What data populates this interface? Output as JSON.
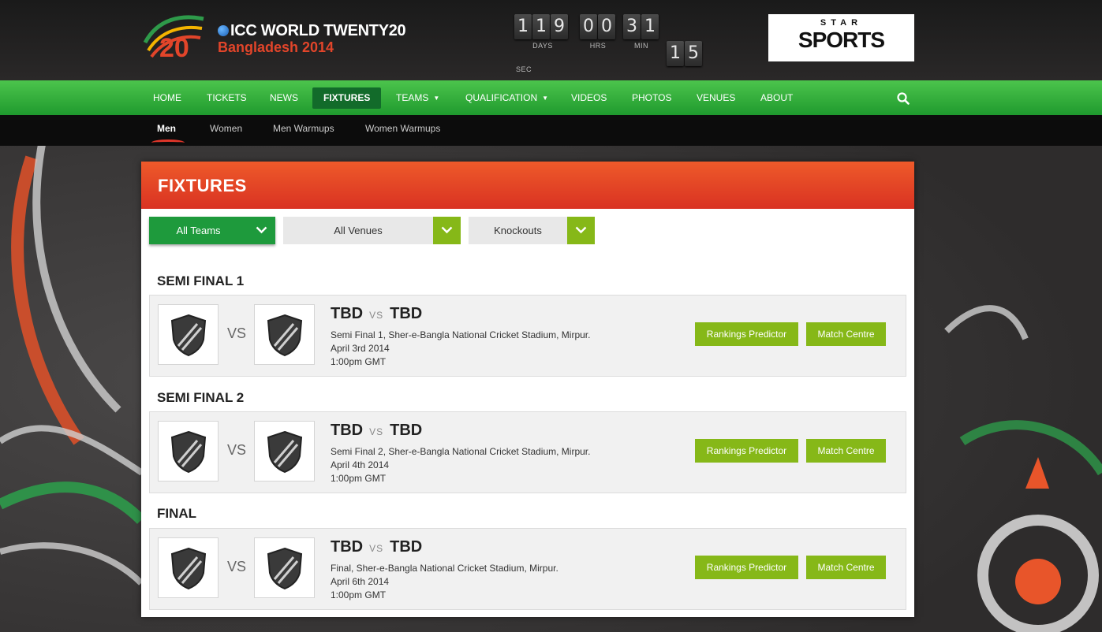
{
  "header": {
    "logo_number": "20",
    "title": "ICC WORLD TWENTY20",
    "subtitle": "Bangladesh 2014",
    "countdown": {
      "days": [
        "1",
        "1",
        "9"
      ],
      "hours": [
        "0",
        "0"
      ],
      "minutes": [
        "3",
        "1"
      ],
      "seconds": [
        "1",
        "5"
      ],
      "labels": {
        "days": "DAYS",
        "hours": "HRS",
        "minutes": "MIN",
        "seconds": "SEC"
      }
    },
    "sponsor": {
      "top": "STAR",
      "main": "SPORTS"
    }
  },
  "nav": {
    "items": [
      {
        "label": "HOME"
      },
      {
        "label": "TICKETS"
      },
      {
        "label": "NEWS"
      },
      {
        "label": "FIXTURES",
        "active": true
      },
      {
        "label": "TEAMS",
        "dropdown": true
      },
      {
        "label": "QUALIFICATION",
        "dropdown": true
      },
      {
        "label": "VIDEOS"
      },
      {
        "label": "PHOTOS"
      },
      {
        "label": "VENUES"
      },
      {
        "label": "ABOUT"
      }
    ],
    "search_icon": "search-icon"
  },
  "subnav": {
    "items": [
      {
        "label": "Men",
        "active": true
      },
      {
        "label": "Women"
      },
      {
        "label": "Men Warmups"
      },
      {
        "label": "Women Warmups"
      }
    ]
  },
  "panel": {
    "title": "FIXTURES",
    "filters": {
      "teams": "All Teams",
      "venues": "All Venues",
      "stage": "Knockouts"
    },
    "sections": [
      {
        "title": "SEMI FINAL 1",
        "match": {
          "team1": "TBD",
          "vs_small": "VS",
          "team2": "TBD",
          "vs_big": "VS",
          "venue": "Semi Final 1, Sher-e-Bangla National Cricket Stadium, Mirpur.",
          "date": "April 3rd 2014",
          "time": "1:00pm GMT",
          "predictor_label": "Rankings Predictor",
          "centre_label": "Match Centre"
        }
      },
      {
        "title": "SEMI FINAL 2",
        "match": {
          "team1": "TBD",
          "vs_small": "VS",
          "team2": "TBD",
          "vs_big": "VS",
          "venue": "Semi Final 2, Sher-e-Bangla National Cricket Stadium, Mirpur.",
          "date": "April 4th 2014",
          "time": "1:00pm GMT",
          "predictor_label": "Rankings Predictor",
          "centre_label": "Match Centre"
        }
      },
      {
        "title": "FINAL",
        "match": {
          "team1": "TBD",
          "vs_small": "VS",
          "team2": "TBD",
          "vs_big": "VS",
          "venue": "Final, Sher-e-Bangla National Cricket Stadium, Mirpur.",
          "date": "April 6th 2014",
          "time": "1:00pm GMT",
          "predictor_label": "Rankings Predictor",
          "centre_label": "Match Centre"
        }
      }
    ]
  },
  "colors": {
    "nav_green": "#1f9a2e",
    "header_red": "#d93222",
    "button_green": "#86b818",
    "filter_green": "#1e9a3c"
  }
}
